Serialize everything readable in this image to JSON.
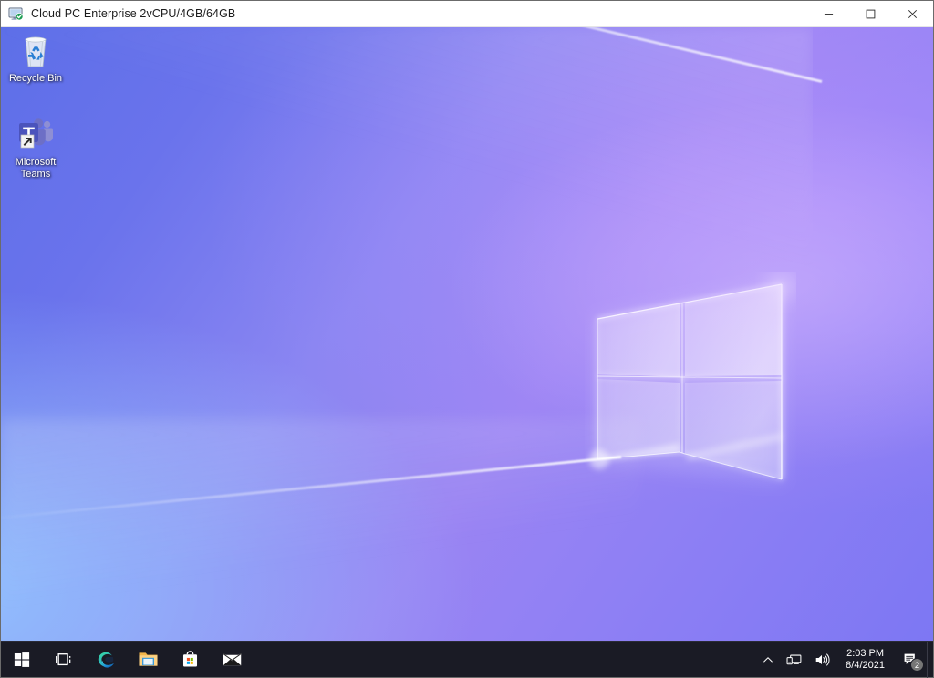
{
  "window": {
    "title": "Cloud PC Enterprise 2vCPU/4GB/64GB",
    "icon": "remote-desktop-connected-icon",
    "controls": {
      "minimize_label": "–",
      "maximize_label": "☐",
      "close_label": "✕",
      "minimize_name": "Minimize",
      "maximize_name": "Maximize",
      "close_name": "Close"
    }
  },
  "desktop": {
    "wallpaper": {
      "name": "windows-10-light-hero-wallpaper",
      "colors": {
        "top_left": "#5d6fe8",
        "top_right": "#9575ee",
        "bottom_left": "#9fc2f5",
        "bottom_right": "#7b72f2",
        "logo_glow": "#ffffff"
      }
    },
    "icons": [
      {
        "label": "Recycle Bin",
        "icon": "recycle-bin-icon",
        "shortcut": false
      },
      {
        "label": "Microsoft Teams",
        "icon": "microsoft-teams-icon",
        "shortcut": true
      }
    ]
  },
  "taskbar": {
    "background": "#1a1b25",
    "buttons": [
      {
        "name": "start-button",
        "icon": "windows-logo-icon",
        "label": "Start"
      },
      {
        "name": "task-view-button",
        "icon": "task-view-icon",
        "label": "Task View"
      },
      {
        "name": "edge-button",
        "icon": "microsoft-edge-icon",
        "label": "Microsoft Edge"
      },
      {
        "name": "file-explorer-button",
        "icon": "file-explorer-icon",
        "label": "File Explorer"
      },
      {
        "name": "microsoft-store-button",
        "icon": "microsoft-store-icon",
        "label": "Microsoft Store"
      },
      {
        "name": "mail-button",
        "icon": "mail-envelope-icon",
        "label": "Mail"
      }
    ],
    "tray": {
      "overflow": {
        "icon": "chevron-up-icon",
        "label": "Show hidden icons"
      },
      "network": {
        "icon": "network-monitor-icon",
        "label": "Network"
      },
      "volume": {
        "icon": "speaker-volume-icon",
        "label": "Volume"
      },
      "clock": {
        "time": "2:03 PM",
        "date": "8/4/2021"
      },
      "action_center": {
        "icon": "action-center-icon",
        "label": "Notifications",
        "badge_count": "2",
        "badge_color": "#767676"
      }
    }
  }
}
